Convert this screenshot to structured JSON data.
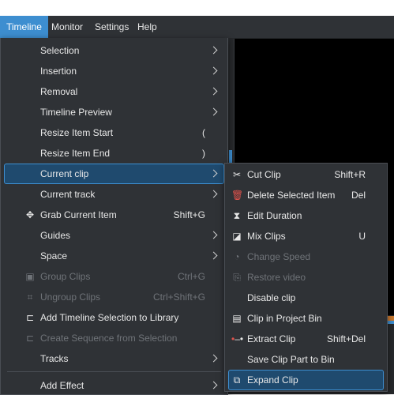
{
  "colors": {
    "accent": "#3d8ed0",
    "menu_bg": "#2f3236",
    "delete_icon": "#e0524b"
  },
  "menubar": {
    "items": [
      "Timeline",
      "Monitor",
      "Settings",
      "Help"
    ],
    "active": "Timeline"
  },
  "timeline_menu": {
    "items": [
      {
        "label": "Selection",
        "submenu": true
      },
      {
        "label": "Insertion",
        "submenu": true
      },
      {
        "label": "Removal",
        "submenu": true
      },
      {
        "label": "Timeline Preview",
        "submenu": true
      },
      {
        "label": "Resize Item Start",
        "shortcut": "("
      },
      {
        "label": "Resize Item End",
        "shortcut": ")"
      },
      {
        "label": "Current clip",
        "submenu": true,
        "highlighted": true
      },
      {
        "label": "Current track",
        "submenu": true
      },
      {
        "label": "Grab Current Item",
        "shortcut": "Shift+G",
        "icon": "move-icon"
      },
      {
        "label": "Guides",
        "submenu": true
      },
      {
        "label": "Space",
        "submenu": true
      },
      {
        "label": "Group Clips",
        "shortcut": "Ctrl+G",
        "icon": "group-icon",
        "disabled": true
      },
      {
        "label": "Ungroup Clips",
        "shortcut": "Ctrl+Shift+G",
        "icon": "ungroup-icon",
        "disabled": true
      },
      {
        "label": "Add Timeline Selection to Library",
        "icon": "bookmark-icon"
      },
      {
        "label": "Create Sequence from Selection",
        "icon": "bookmark-icon",
        "disabled": true
      },
      {
        "label": "Tracks",
        "submenu": true
      },
      {
        "label": "Add Effect",
        "submenu": true
      }
    ]
  },
  "current_clip_menu": {
    "items": [
      {
        "label": "Cut Clip",
        "shortcut": "Shift+R",
        "icon": "scissors-icon"
      },
      {
        "label": "Delete Selected Item",
        "shortcut": "Del",
        "icon": "trash-icon"
      },
      {
        "label": "Edit Duration",
        "icon": "duration-icon"
      },
      {
        "label": "Mix Clips",
        "shortcut": "U",
        "icon": "mix-icon"
      },
      {
        "label": "Change Speed",
        "icon": "speed-icon",
        "disabled": true
      },
      {
        "label": "Restore video",
        "icon": "restore-icon",
        "disabled": true
      },
      {
        "label": "Disable clip"
      },
      {
        "label": "Clip in Project Bin",
        "icon": "bin-icon"
      },
      {
        "label": "Extract Clip",
        "shortcut": "Shift+Del",
        "icon": "extract-icon"
      },
      {
        "label": "Save Clip Part to Bin"
      },
      {
        "label": "Expand Clip",
        "icon": "expand-icon",
        "highlighted": true
      }
    ]
  }
}
